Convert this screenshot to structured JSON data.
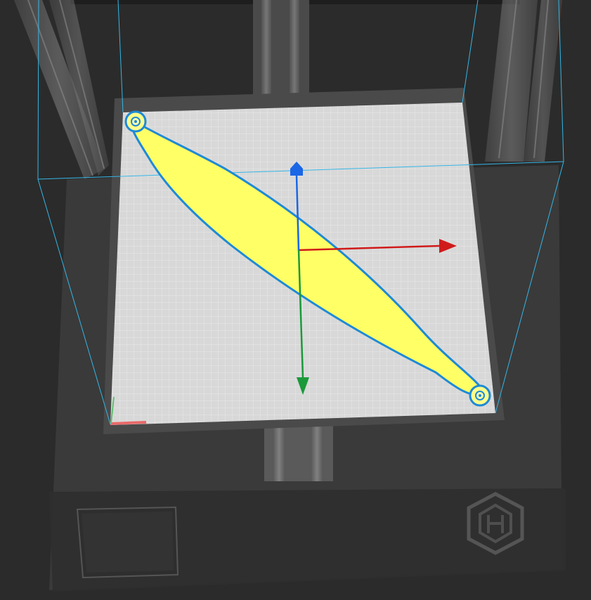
{
  "viewport": {
    "name": "3d-slicer-viewport",
    "colors": {
      "background": "#2b2b2b",
      "printer_body": "#3a3a3a",
      "printer_body_dark": "#2f2f2f",
      "frame_rail": "#6a6a6a",
      "bed_plate": "#4a4a4a",
      "bed_surface": "#d8d8d8",
      "grid_line": "#ffffff",
      "build_volume": "#35b6e6",
      "model_fill": "#ffff66",
      "model_outline": "#1e8ad6",
      "axis_x": "#d01a1a",
      "axis_y": "#1a9a3a",
      "axis_z": "#1a66e6"
    },
    "icons": {
      "axis_x": "x-axis-arrow-icon",
      "axis_y": "y-axis-arrow-icon",
      "axis_z": "z-axis-arrow-icon",
      "brand_logo": "printer-brand-logo-icon"
    },
    "model": {
      "selected": true
    }
  }
}
